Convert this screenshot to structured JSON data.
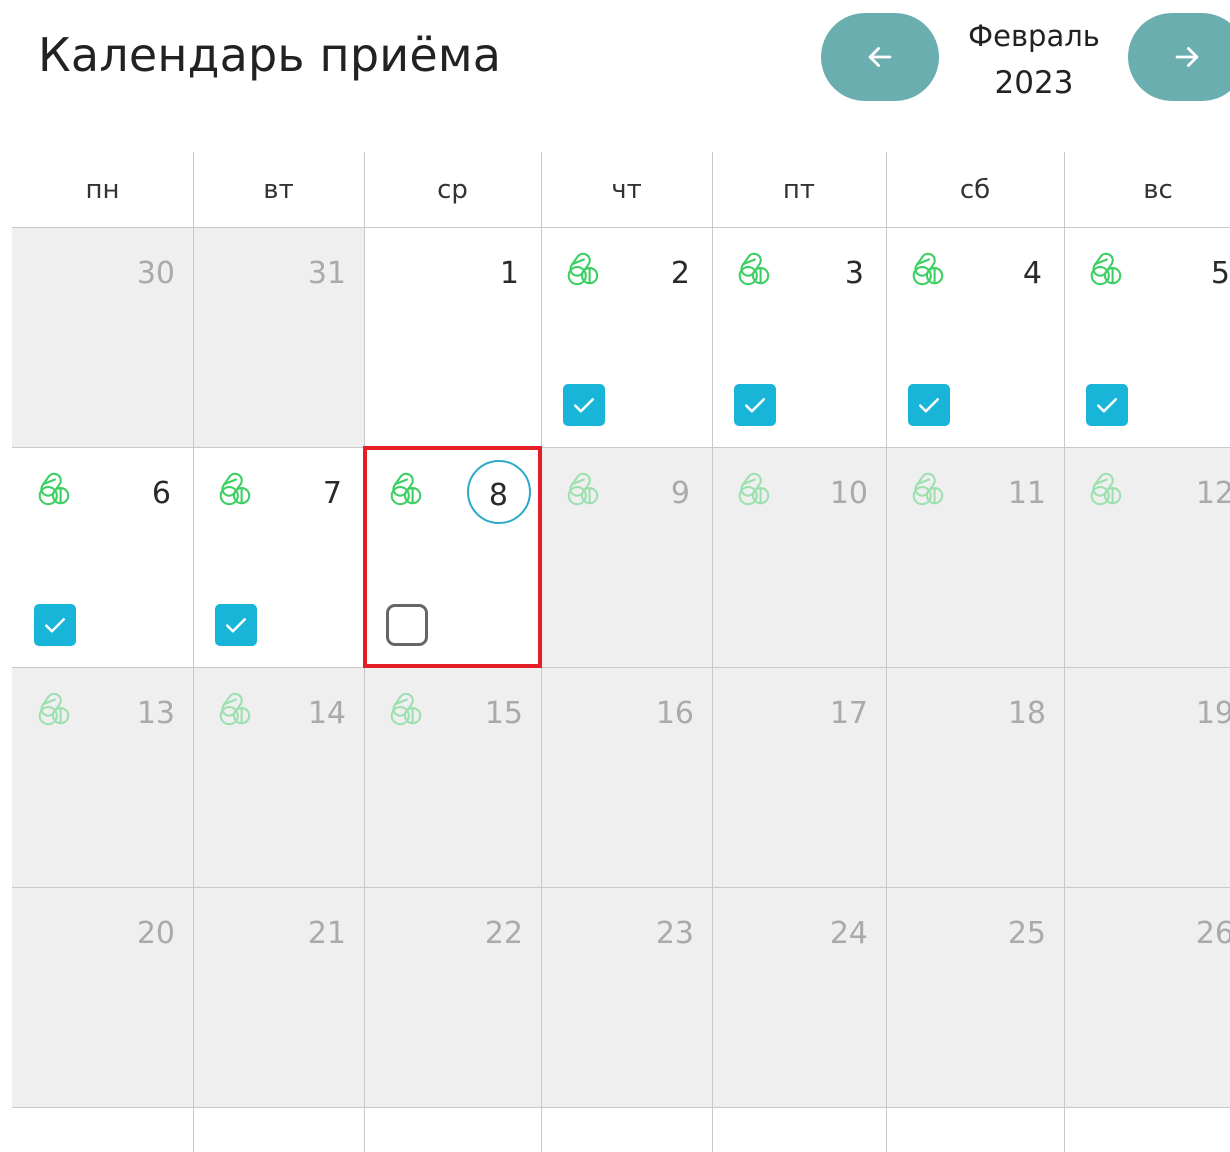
{
  "header": {
    "title": "Календарь приёма",
    "month": "Февраль",
    "year": "2023",
    "prev_icon": "arrow-left-icon",
    "next_icon": "arrow-right-icon"
  },
  "weekdays": [
    "пн",
    "вт",
    "ср",
    "чт",
    "пт",
    "сб",
    "вс"
  ],
  "weeks": [
    [
      {
        "day": "30",
        "outside": true
      },
      {
        "day": "31",
        "outside": true
      },
      {
        "day": "1"
      },
      {
        "day": "2",
        "pill": true,
        "checked": true
      },
      {
        "day": "3",
        "pill": true,
        "checked": true
      },
      {
        "day": "4",
        "pill": true,
        "checked": true
      },
      {
        "day": "5",
        "pill": true,
        "checked": true
      }
    ],
    [
      {
        "day": "6",
        "pill": true,
        "checked": true
      },
      {
        "day": "7",
        "pill": true,
        "checked": true
      },
      {
        "day": "8",
        "pill": true,
        "checked": false,
        "today": true,
        "selected": true
      },
      {
        "day": "9",
        "pill": true,
        "future": true
      },
      {
        "day": "10",
        "pill": true,
        "future": true
      },
      {
        "day": "11",
        "pill": true,
        "future": true
      },
      {
        "day": "12",
        "pill": true,
        "future": true
      }
    ],
    [
      {
        "day": "13",
        "pill": true,
        "future": true
      },
      {
        "day": "14",
        "pill": true,
        "future": true
      },
      {
        "day": "15",
        "pill": true,
        "future": true
      },
      {
        "day": "16",
        "future": true
      },
      {
        "day": "17",
        "future": true
      },
      {
        "day": "18",
        "future": true
      },
      {
        "day": "19",
        "future": true
      }
    ],
    [
      {
        "day": "20",
        "future": true
      },
      {
        "day": "21",
        "future": true
      },
      {
        "day": "22",
        "future": true
      },
      {
        "day": "23",
        "future": true
      },
      {
        "day": "24",
        "future": true
      },
      {
        "day": "25",
        "future": true
      },
      {
        "day": "26",
        "future": true
      }
    ]
  ],
  "colors": {
    "accent_button": "#6aaeb0",
    "checkbox": "#18b5d8",
    "pill_icon": "#3ccf63",
    "today_ring": "#2aa8c8",
    "highlight": "#e41e26",
    "past_bg": "#efefef"
  }
}
